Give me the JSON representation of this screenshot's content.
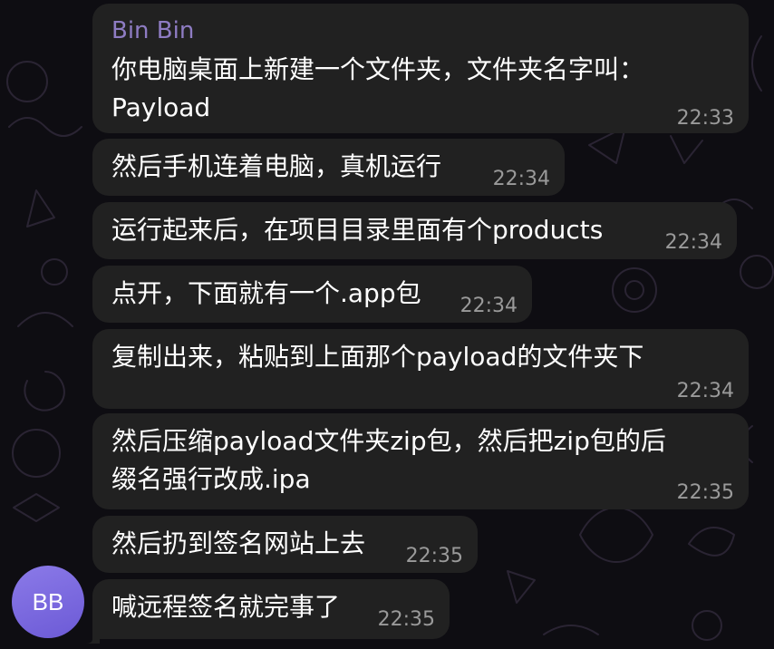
{
  "theme": {
    "background": "#0e0d12",
    "bubble": "#212121",
    "sender_color": "#8e7cc3",
    "time_color": "#9a9a9a",
    "avatar_color": "#7b69df"
  },
  "chat": {
    "sender": "Bin Bin",
    "avatar_initials": "BB",
    "messages": [
      {
        "text": "你电脑桌面上新建一个文件夹，文件夹名字叫：\nPayload",
        "time": "22:33"
      },
      {
        "text": "然后手机连着电脑，真机运行",
        "time": "22:34"
      },
      {
        "text": "运行起来后，在项目目录里面有个products",
        "time": "22:34"
      },
      {
        "text": "点开，下面就有一个.app包",
        "time": "22:34"
      },
      {
        "text": "复制出来，粘贴到上面那个payload的文件夹下",
        "time": "22:34"
      },
      {
        "text": "然后压缩payload文件夹zip包，然后把zip包的后\n缀名强行改成.ipa",
        "time": "22:35"
      },
      {
        "text": "然后扔到签名网站上去",
        "time": "22:35"
      },
      {
        "text": "喊远程签名就完事了",
        "time": "22:35"
      }
    ]
  }
}
